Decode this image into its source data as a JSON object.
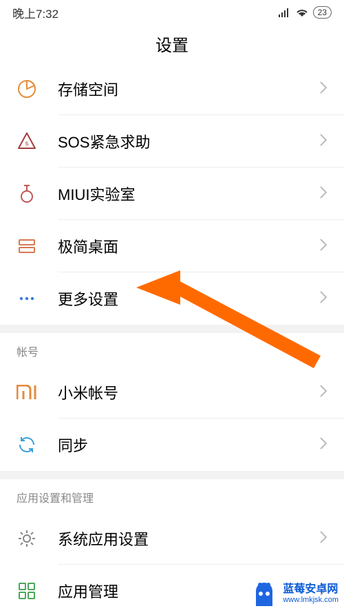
{
  "status": {
    "time": "晚上7:32",
    "battery": "23"
  },
  "title": "设置",
  "rows": [
    {
      "id": "storage",
      "label": "存储空间",
      "iconColor": "#e38f3a"
    },
    {
      "id": "sos",
      "label": "SOS紧急求助",
      "iconColor": "#a33f3f"
    },
    {
      "id": "miui-lab",
      "label": "MIUI实验室",
      "iconColor": "#c05858"
    },
    {
      "id": "simple-home",
      "label": "极简桌面",
      "iconColor": "#d87a52"
    },
    {
      "id": "more",
      "label": "更多设置",
      "iconColor": "#3a7ad8"
    }
  ],
  "section_account": {
    "header": "帐号",
    "rows": [
      {
        "id": "mi-account",
        "label": "小米帐号",
        "iconColor": "#e68a3a"
      },
      {
        "id": "sync",
        "label": "同步",
        "iconColor": "#3a9ede"
      }
    ]
  },
  "section_apps": {
    "header": "应用设置和管理",
    "rows": [
      {
        "id": "sys-app-settings",
        "label": "系统应用设置",
        "iconColor": "#888888"
      },
      {
        "id": "app-manage",
        "label": "应用管理",
        "iconColor": "#4aa85a"
      }
    ]
  },
  "watermark": {
    "title": "蓝莓安卓网",
    "url": "www.lmkjsk.com"
  }
}
